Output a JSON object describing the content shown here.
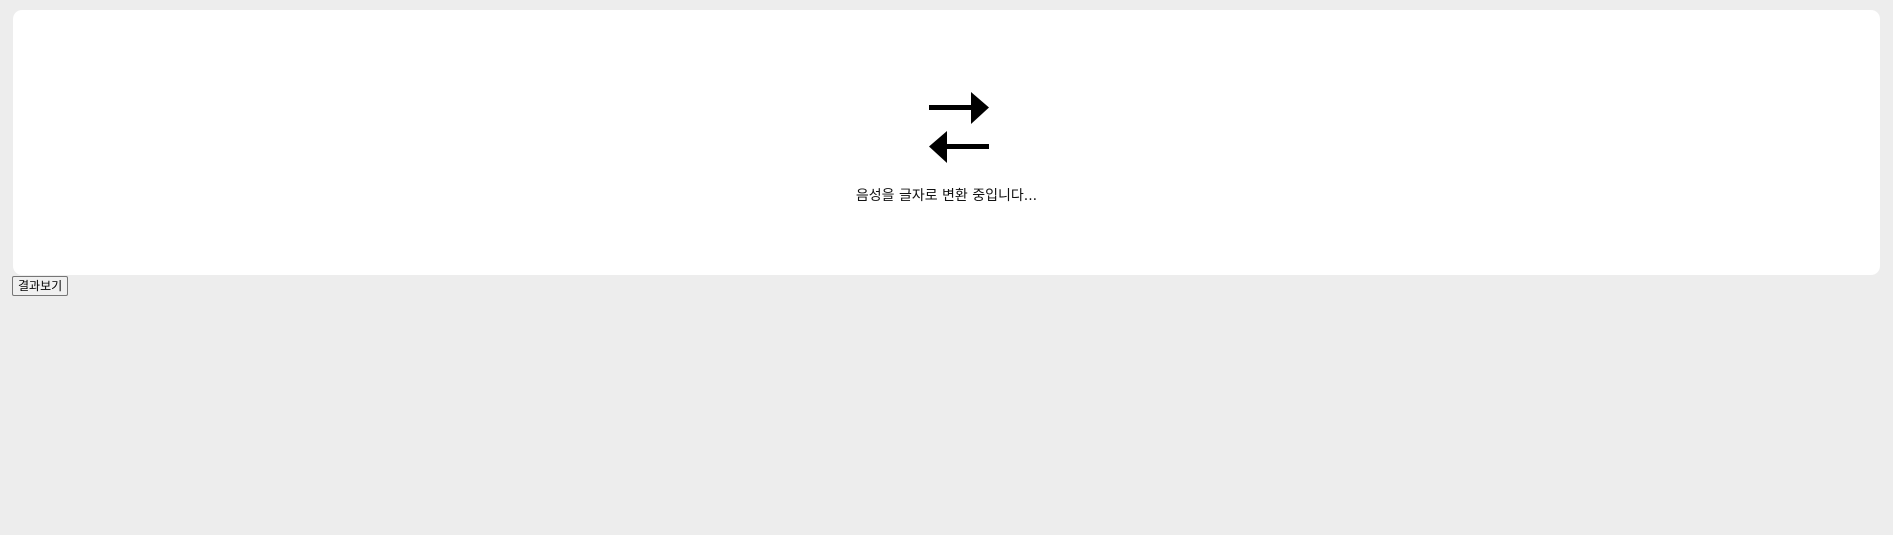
{
  "loading_panel": {
    "icon": "swap-arrows-icon",
    "status_text": "음성을 글자로 변환 중입니다..."
  },
  "actions": {
    "view_results_label": "결과보기"
  },
  "colors": {
    "page_background": "#ededed",
    "panel_background": "#ffffff",
    "icon_color": "#000000"
  }
}
